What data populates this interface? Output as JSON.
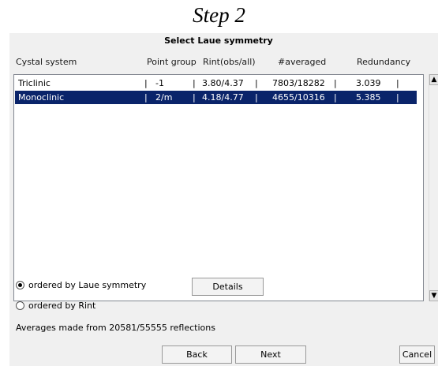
{
  "step_title": "Step 2",
  "dialog": {
    "title": "Select Laue symmetry",
    "headers": {
      "crystal_system": "Cystal system",
      "point_group": "Point group",
      "rint": "Rint(obs/all)",
      "averaged": "#averaged",
      "redundancy": "Redundancy"
    },
    "rows": [
      {
        "crystal_system": "Triclinic",
        "point_group": "-1",
        "rint": "3.80/4.37",
        "averaged": "7803/18282",
        "redundancy": "3.039",
        "selected": false
      },
      {
        "crystal_system": "Monoclinic",
        "point_group": "2/m",
        "rint": "4.18/4.77",
        "averaged": "4655/10316",
        "redundancy": "5.385",
        "selected": true
      }
    ],
    "separator": "|",
    "scroll_up_icon": "▲",
    "scroll_down_icon": "▼",
    "order_options": [
      {
        "label": "ordered by Laue symmetry",
        "checked": true
      },
      {
        "label": "ordered by Rint",
        "checked": false
      }
    ],
    "details_label": "Details",
    "info": "Averages made from 20581/55555 reflections",
    "back_label": "Back",
    "next_label": "Next",
    "cancel_label": "Cancel",
    "selection_color": "#0a246a"
  }
}
